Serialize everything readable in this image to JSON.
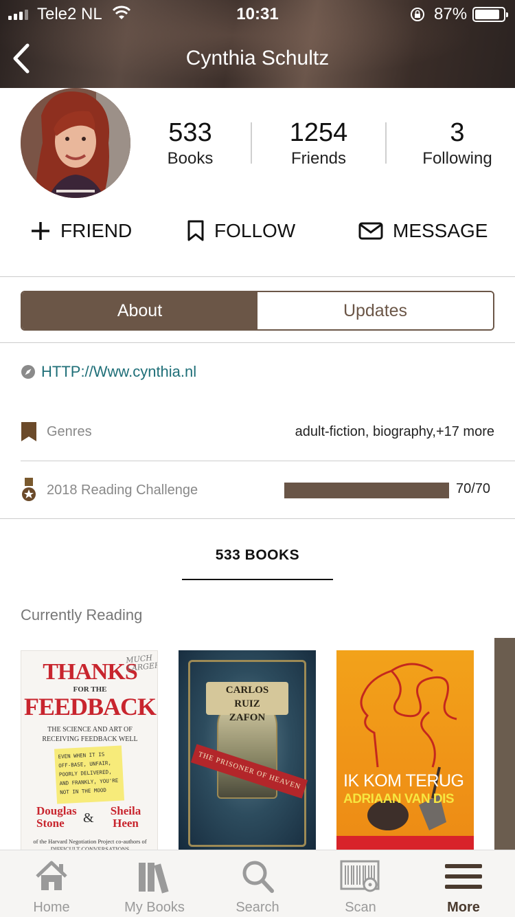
{
  "status_bar": {
    "carrier": "Tele2 NL",
    "time": "10:31",
    "battery": "87%"
  },
  "header": {
    "title": "Cynthia Schultz"
  },
  "stats": [
    {
      "value": "533",
      "label": "Books"
    },
    {
      "value": "1254",
      "label": "Friends"
    },
    {
      "value": "3",
      "label": "Following"
    }
  ],
  "actions": {
    "friend": "FRIEND",
    "follow": "FOLLOW",
    "message": "MESSAGE"
  },
  "segments": {
    "about": "About",
    "updates": "Updates"
  },
  "about": {
    "website": "HTTP://Www.cynthia.nl",
    "genres_label": "Genres",
    "genres_value": "adult-fiction, biography,+17 more",
    "challenge_label": "2018 Reading Challenge",
    "challenge_count": "70/70",
    "challenge_progress": 1.0
  },
  "books_tab": "533 BOOKS",
  "currently_reading_title": "Currently Reading",
  "covers": {
    "c1": {
      "title_top": "THANKS",
      "for_the": "FOR THE",
      "title_main": "FEEDBACK",
      "subtitle": "THE SCIENCE AND ART OF RECEIVING FEEDBACK WELL",
      "handwritten": "MUCH LARGER",
      "note": "EVEN WHEN IT IS OFF-BASE, UNFAIR, POORLY DELIVERED, AND FRANKLY, YOU'RE NOT IN THE MOOD",
      "author1": "Douglas Stone",
      "amp": "&",
      "author2": "Sheila Heen",
      "footer": "of the Harvard Negotiation Project co-authors of DIFFICULT CONVERSATIONS"
    },
    "c2": {
      "author": "CARLOS RUIZ ZAFON",
      "title": "THE PRISONER OF HEAVEN"
    },
    "c3": {
      "title": "IK KOM TERUG",
      "author": "ADRIAAN VAN DIS"
    }
  },
  "tabbar": [
    {
      "label": "Home",
      "icon": "home-icon"
    },
    {
      "label": "My Books",
      "icon": "books-icon"
    },
    {
      "label": "Search",
      "icon": "search-icon"
    },
    {
      "label": "Scan",
      "icon": "barcode-scan-icon"
    },
    {
      "label": "More",
      "icon": "menu-icon",
      "active": true
    }
  ],
  "colors": {
    "accent": "#6b5647",
    "link": "#1f6f78",
    "active_tab": "#4a3a2e"
  }
}
